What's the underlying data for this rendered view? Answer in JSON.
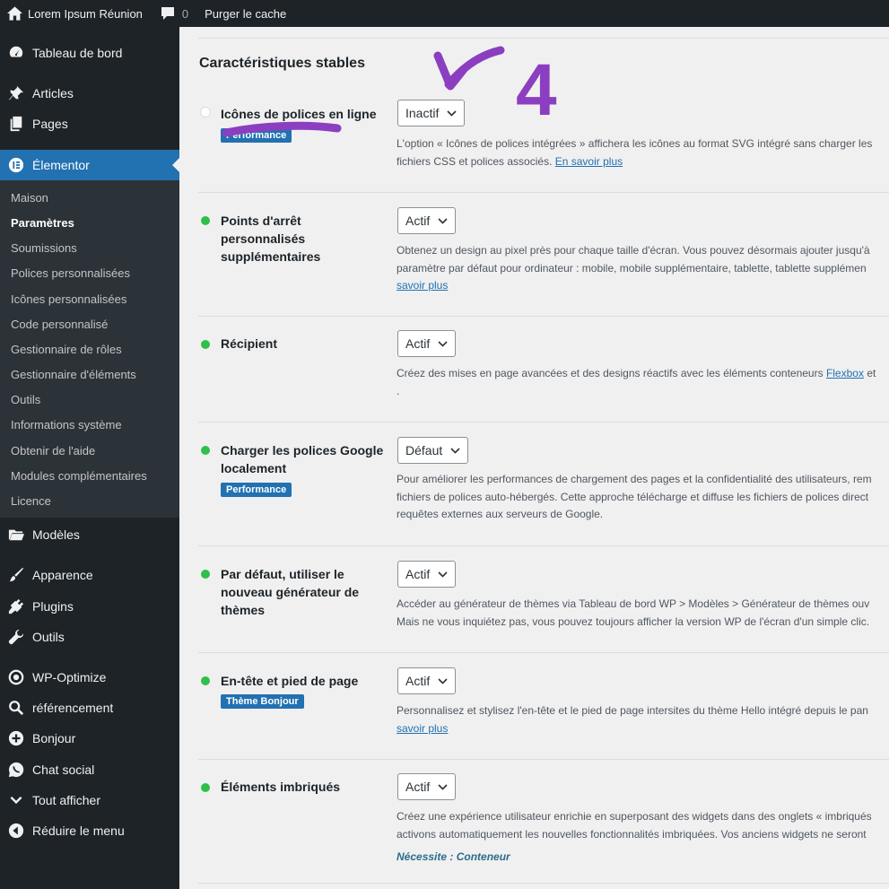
{
  "adminbar": {
    "site_name": "Lorem Ipsum Réunion",
    "comments_count": "0",
    "purge_label": "Purger le cache"
  },
  "sidebar": {
    "items": [
      {
        "label": "Tableau de bord",
        "icon": "dashboard-icon"
      },
      {
        "label": "Articles",
        "icon": "pin-icon"
      },
      {
        "label": "Pages",
        "icon": "pages-icon"
      },
      {
        "label": "Élementor",
        "icon": "elementor-icon"
      },
      {
        "label": "Modèles",
        "icon": "folder-icon"
      },
      {
        "label": "Apparence",
        "icon": "brush-icon"
      },
      {
        "label": "Plugins",
        "icon": "plugin-icon"
      },
      {
        "label": "Outils",
        "icon": "wrench-icon"
      },
      {
        "label": "WP-Optimize",
        "icon": "wp-optimize-icon"
      },
      {
        "label": "référencement",
        "icon": "search-icon"
      },
      {
        "label": "Bonjour",
        "icon": "plus-circle-icon"
      },
      {
        "label": "Chat social",
        "icon": "whatsapp-icon"
      },
      {
        "label": "Tout afficher",
        "icon": "chevron-down-icon"
      },
      {
        "label": "Réduire le menu",
        "icon": "collapse-icon"
      }
    ],
    "submenu": [
      "Maison",
      "Paramètres",
      "Soumissions",
      "Polices personnalisées",
      "Icônes personnalisées",
      "Code personnalisé",
      "Gestionnaire de rôles",
      "Gestionnaire d'éléments",
      "Outils",
      "Informations système",
      "Obtenir de l'aide",
      "Modules complémentaires",
      "Licence"
    ],
    "active_submenu": "Paramètres"
  },
  "section_title": "Caractéristiques stables",
  "features": [
    {
      "name": "Icônes de polices en ligne",
      "status": "off",
      "tag": "Performance",
      "value": "Inactif",
      "desc": [
        "L'option « Icônes de polices intégrées » affichera les icônes au format SVG intégré sans charger les",
        "fichiers CSS et polices associés. "
      ],
      "link": "En savoir plus"
    },
    {
      "name": "Points d'arrêt personnalisés supplémentaires",
      "status": "on",
      "value": "Actif",
      "desc": [
        "Obtenez un design au pixel près pour chaque taille d'écran. Vous pouvez désormais ajouter jusqu'à",
        "paramètre par défaut pour ordinateur : mobile, mobile supplémentaire, tablette, tablette supplémen"
      ],
      "link": "savoir plus"
    },
    {
      "name": "Récipient",
      "status": "on",
      "value": "Actif",
      "desc": [
        "Créez des mises en page avancées et des designs réactifs avec les éléments conteneurs "
      ],
      "link": "Flexbox",
      "link2": "et",
      "trail": "."
    },
    {
      "name": "Charger les polices Google localement",
      "status": "on",
      "tag": "Performance",
      "value": "Défaut",
      "desc": [
        "Pour améliorer les performances de chargement des pages et la confidentialité des utilisateurs, rem",
        "fichiers de polices auto-hébergés. Cette approche télécharge et diffuse les fichiers de polices direct",
        "requêtes externes aux serveurs de Google."
      ]
    },
    {
      "name": "Par défaut, utiliser le nouveau générateur de thèmes",
      "status": "on",
      "value": "Actif",
      "desc": [
        "Accéder au générateur de thèmes via Tableau de bord WP > Modèles > Générateur de thèmes ouv",
        "Mais ne vous inquiétez pas, vous pouvez toujours afficher la version WP de l'écran d'un simple clic."
      ]
    },
    {
      "name": "En-tête et pied de page",
      "status": "on",
      "tag": "Thème Bonjour",
      "value": "Actif",
      "desc": [
        "Personnalisez et stylisez l'en-tête et le pied de page intersites du thème Hello intégré depuis le pan"
      ],
      "link": "savoir plus"
    },
    {
      "name": "Éléments imbriqués",
      "status": "on",
      "value": "Actif",
      "desc": [
        "Créez une expérience utilisateur enrichie en superposant des widgets dans des onglets « imbriqués",
        "activons automatiquement les nouvelles fonctionnalités imbriquées. Vos anciens widgets ne seront"
      ],
      "requires": "Nécessite : Conteneur"
    }
  ],
  "annotation": {
    "number": "4",
    "color": "#8b3fc0"
  },
  "colors": {
    "accent": "#2271b1",
    "sidebar_bg": "#1d2327",
    "status_on": "#2fbf4b"
  }
}
